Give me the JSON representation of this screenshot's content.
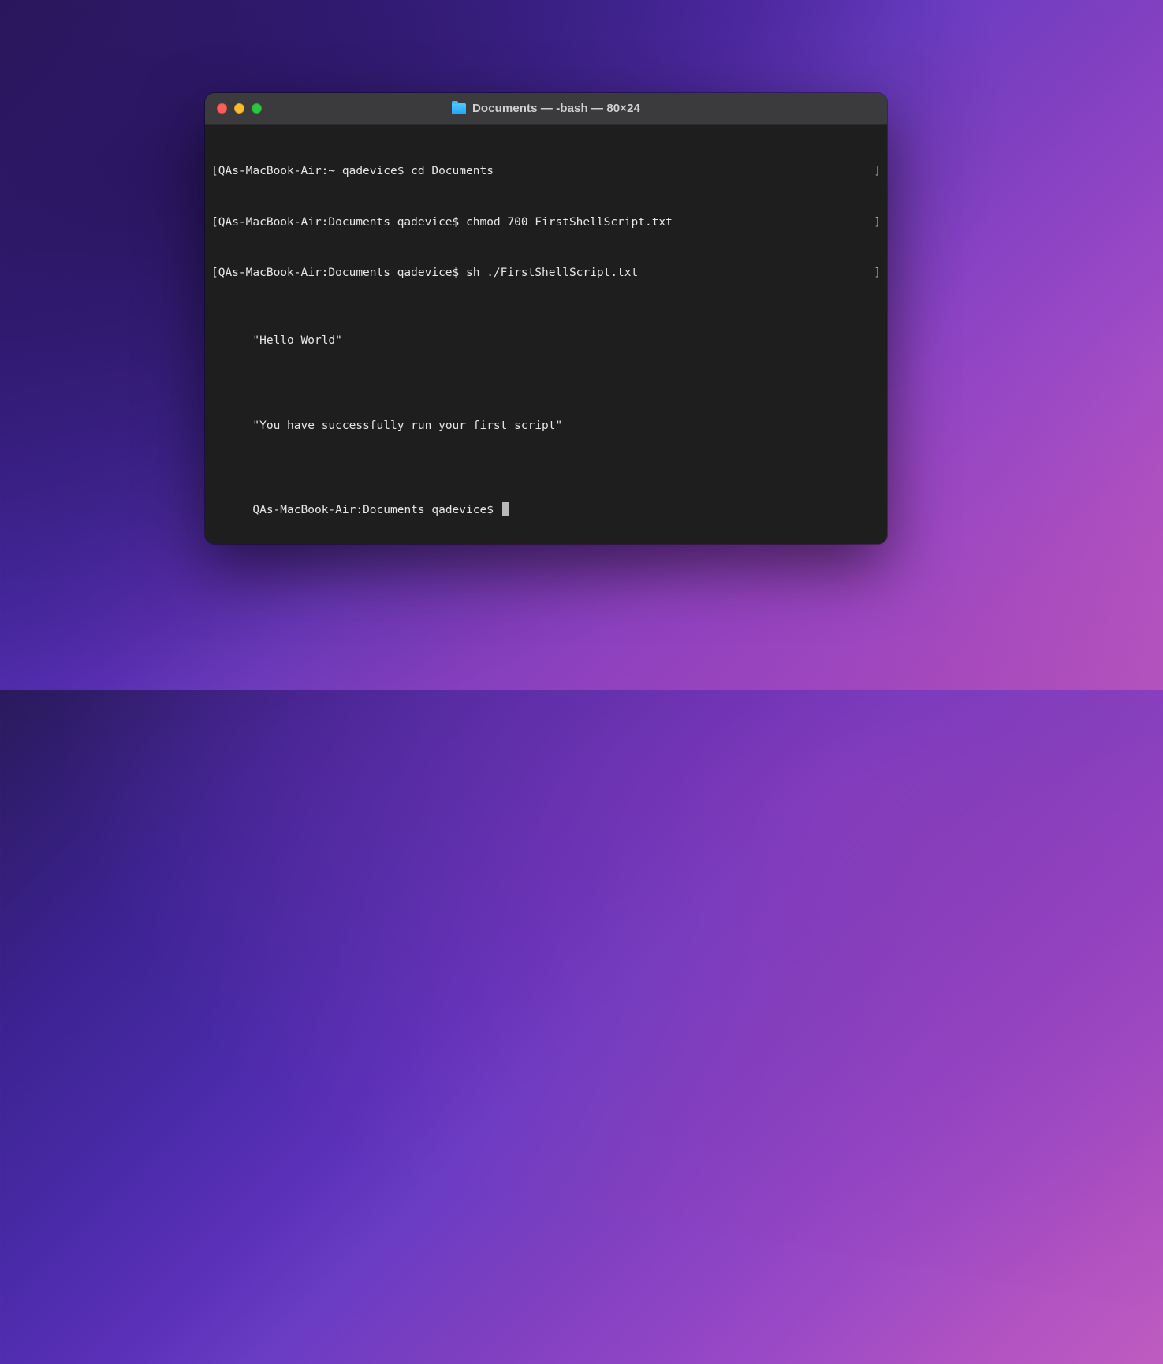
{
  "window": {
    "title": "Documents — -bash — 80×24"
  },
  "terminal": {
    "lines": [
      {
        "left": "[QAs-MacBook-Air:~ qadevice$ cd Documents",
        "right": "]"
      },
      {
        "left": "[QAs-MacBook-Air:Documents qadevice$ chmod 700 FirstShellScript.txt",
        "right": "]"
      },
      {
        "left": "[QAs-MacBook-Air:Documents qadevice$ sh ./FirstShellScript.txt",
        "right": "]"
      },
      {
        "left": "\"Hello World\"",
        "right": ""
      },
      {
        "left": "\"You have successfully run your first script\"",
        "right": ""
      }
    ],
    "prompt": "QAs-MacBook-Air:Documents qadevice$ "
  }
}
